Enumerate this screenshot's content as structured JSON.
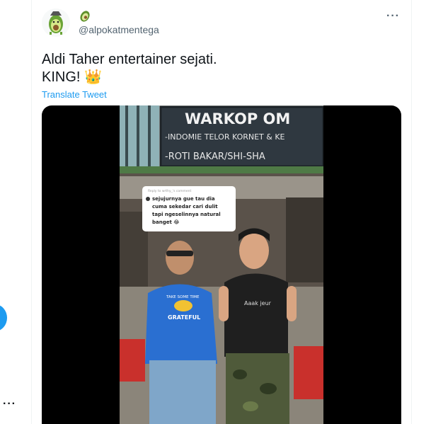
{
  "tweet": {
    "display_name_emoji": "avocado",
    "handle": "@alpokatmentega",
    "text_line1": "Aldi Taher entertainer sejati.",
    "text_line2": "KING! 👑",
    "translate_label": "Translate Tweet",
    "more_label": "···"
  },
  "video": {
    "sign_line1": "WARKOP OM",
    "sign_line2": "-INDOMIE TELOR KORNET & KE",
    "sign_line3": "-ROTI BAKAR/SHI-SHA",
    "comment_header": "Reply to wrthy_'s comment",
    "comment_line1": "sejujurnya gue tau dia",
    "comment_line2": "cuma sekedar cari dulit",
    "comment_line3": "tapi ngeselinnya natural",
    "comment_line4": "banget 😂",
    "shirt_left_top": "TAKE SOME TIME",
    "shirt_left_bottom": "GRATEFUL",
    "shirt_right": "Aaak jeur"
  },
  "sidebar": {
    "more_label": "···"
  },
  "colors": {
    "accent": "#1d9bf0",
    "text": "#0f1419",
    "muted": "#536471"
  }
}
